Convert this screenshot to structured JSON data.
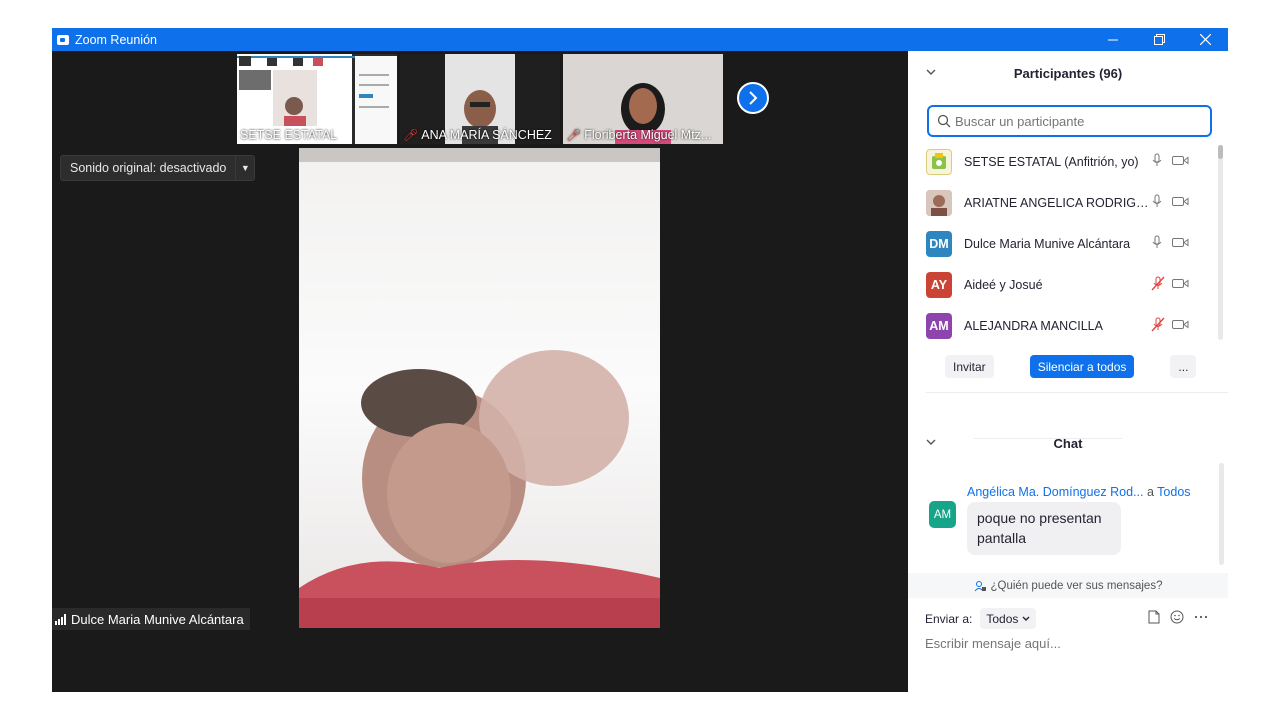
{
  "window": {
    "title": "Zoom Reunión",
    "accent": "#0e71eb"
  },
  "thumbnails": [
    {
      "name": "SETSE ESTATAL",
      "muted": false
    },
    {
      "name": "ANA MARÍA SÁNCHEZ",
      "muted": true
    },
    {
      "name": "Floriberta Miguel Mtz...",
      "muted": true
    }
  ],
  "video": {
    "sound_button": "Sonido original: desactivado",
    "active_speaker": "Dulce Maria Munive Alcántara"
  },
  "participants": {
    "header": "Participantes (96)",
    "search_placeholder": "Buscar un participante",
    "list": [
      {
        "initials": "",
        "name": "SETSE ESTATAL (Anfitrión, yo)",
        "avatar_color": "#c9d96a",
        "muted": false
      },
      {
        "initials": "",
        "name": "ARIATNE ANGELICA RODRIGUE...",
        "avatar_color": "#b58b7a",
        "muted": false
      },
      {
        "initials": "DM",
        "name": "Dulce Maria Munive Alcántara",
        "avatar_color": "#2e86c1",
        "muted": false
      },
      {
        "initials": "AY",
        "name": "Aideé y Josué",
        "avatar_color": "#cb4335",
        "muted": true
      },
      {
        "initials": "AM",
        "name": "ALEJANDRA MANCILLA",
        "avatar_color": "#8e44ad",
        "muted": true
      }
    ],
    "invite": "Invitar",
    "mute_all": "Silenciar a todos",
    "more": "..."
  },
  "chat": {
    "header": "Chat",
    "message": {
      "sender": "Angélica Ma. Domínguez Rod...",
      "to_prefix": "a",
      "to": "Todos",
      "initials": "AM",
      "text": "poque no presentan pantalla"
    },
    "who_sees": "¿Quién puede ver sus mensajes?",
    "send_to_label": "Enviar a:",
    "send_to_value": "Todos",
    "compose_placeholder": "Escribir mensaje aquí..."
  }
}
